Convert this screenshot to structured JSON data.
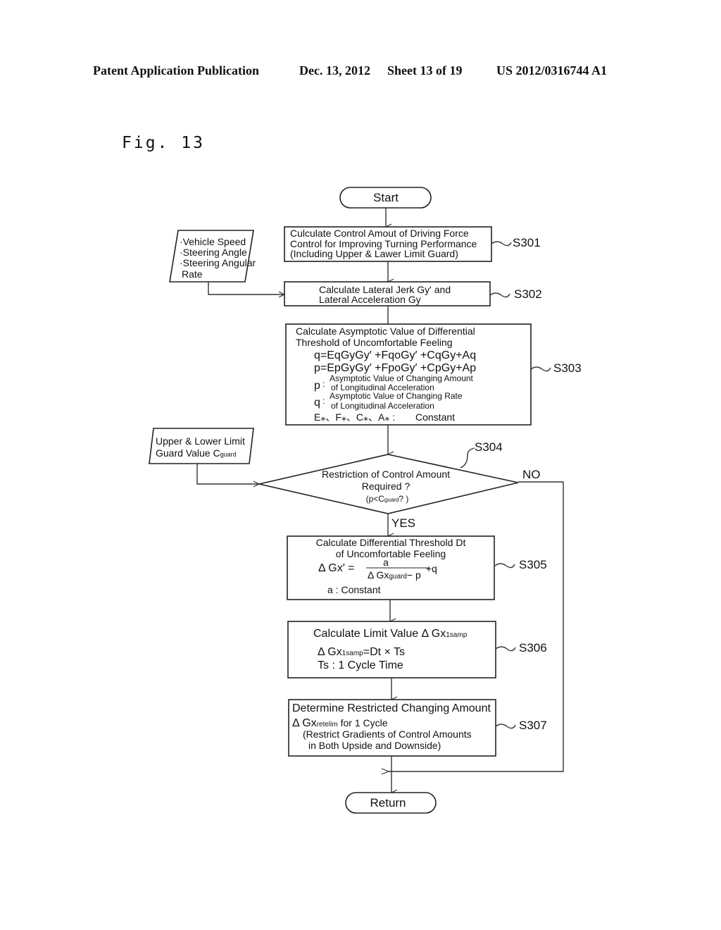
{
  "header": {
    "publication": "Patent Application Publication",
    "date": "Dec. 13, 2012",
    "sheet": "Sheet 13 of 19",
    "number": "US 2012/0316744 A1"
  },
  "figure_label": "Fig. 13",
  "flowchart": {
    "start": "Start",
    "end": "Return",
    "inputs": {
      "vehicle": [
        "·Vehicle Speed",
        "·Steering Angle",
        "·Steering Angular",
        " Rate"
      ],
      "guard": [
        "Upper & Lower Limit",
        "Guard Value C",
        "guard"
      ]
    },
    "steps": [
      {
        "id": "S301",
        "lines": [
          "Culculate Control Amout of Driving Force",
          "Control for Improving Turning Performance",
          "(Including Upper & Lawer Limit Guard)"
        ]
      },
      {
        "id": "S302",
        "lines": [
          "Calculate Lateral Jerk Gy' and",
          "Lateral Acceleration Gy"
        ]
      },
      {
        "id": "S303",
        "lines": [
          "Calculate Asymptotic Value of Differential",
          "Threshold of Uncomfortable Feeling"
        ],
        "equations": [
          "q=EqGyGy′ +FqoGy′ +CqGy+Aq",
          "p=EpGyGy′ +FpoGy′ +CpGy+Ap"
        ],
        "defs": [
          {
            "sym": "p",
            "lines": [
              "Asymptotic Value of Changing Amount",
              "of Longitudinal Acceleration"
            ]
          },
          {
            "sym": "q",
            "lines": [
              "Asymptotic Value of Changing Rate",
              "of Longitudinal Acceleration"
            ]
          }
        ],
        "constants": "E⁎、F⁎、C⁎、A⁎ :",
        "constants_label": "Constant"
      },
      {
        "id": "S304",
        "type": "decision",
        "lines": [
          "Restriction of Control Amount",
          "Required ?",
          "(p<C",
          "guard",
          "? )"
        ],
        "yes": "YES",
        "no": "NO"
      },
      {
        "id": "S305",
        "lines": [
          "Calculate Differential Threshold Dt",
          "of Uncomfortable Feeling"
        ],
        "eq_left": "Δ Gx′ =",
        "eq_num": "a",
        "eq_den": "Δ Gx",
        "eq_den_sub": "guard",
        "eq_den_tail": "− p",
        "eq_tail": "+q",
        "note": "a : Constant"
      },
      {
        "id": "S306",
        "lines": [
          "Calculate Limit Value  Δ Gx",
          "1samp"
        ],
        "eq": "Δ Gx",
        "eq_sub": "1samp",
        "eq_tail": "=Dt × Ts",
        "note": "Ts : 1 Cycle Time"
      },
      {
        "id": "S307",
        "lines": [
          "Determine Restricted Changing Amount",
          "Δ Gx",
          "retelim",
          " for 1 Cycle",
          "(Restrict Gradients of Control Amounts",
          "in Both Upside and Downside)"
        ]
      }
    ]
  }
}
